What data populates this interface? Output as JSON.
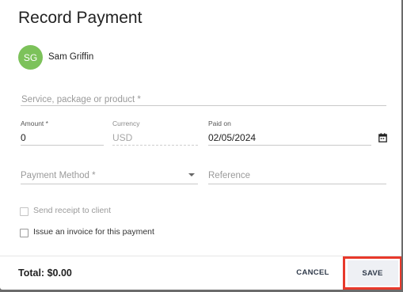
{
  "dialog": {
    "title": "Record Payment",
    "client": {
      "initials": "SG",
      "name": "Sam Griffin",
      "avatar_color": "#7cc25a"
    },
    "service_placeholder": "Service, package or product *",
    "amount": {
      "label": "Amount *",
      "value": "0"
    },
    "currency": {
      "label": "Currency",
      "value": "USD"
    },
    "paid_on": {
      "label": "Paid on",
      "value": "02/05/2024",
      "icon": "calendar-icon"
    },
    "payment_method_placeholder": "Payment Method *",
    "reference_placeholder": "Reference",
    "checkboxes": [
      {
        "label": "Send receipt to client",
        "checked": false,
        "enabled": false
      },
      {
        "label": "Issue an invoice for this payment",
        "checked": false,
        "enabled": true
      }
    ],
    "footer": {
      "total": "Total: $0.00",
      "cancel_label": "CANCEL",
      "save_label": "SAVE",
      "highlight_color": "#e8392b"
    }
  }
}
